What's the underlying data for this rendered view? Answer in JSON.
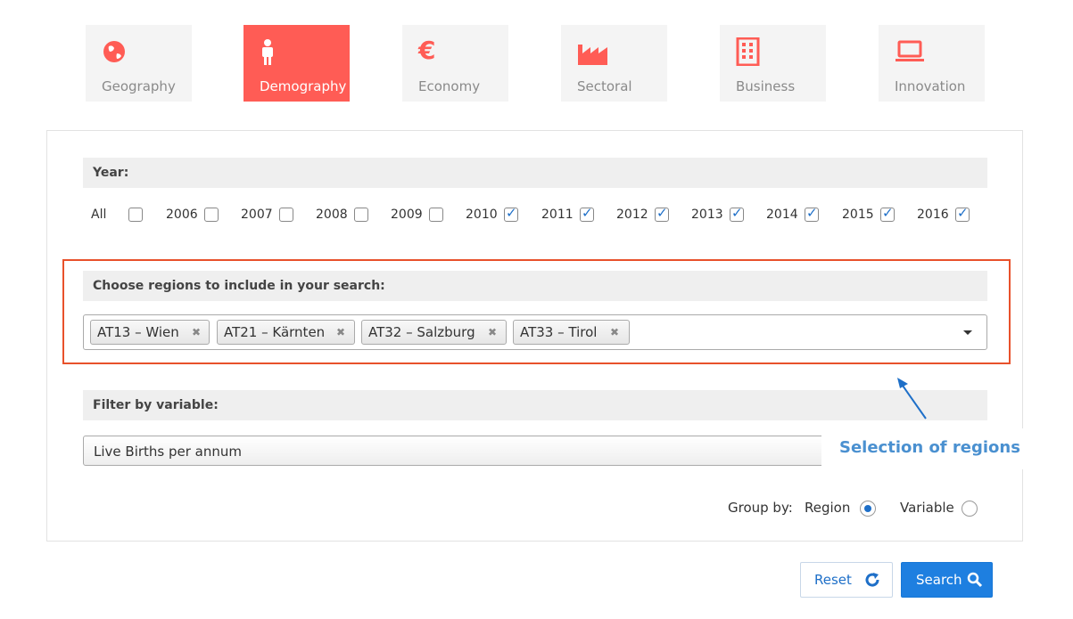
{
  "tabs": [
    {
      "label": "Geography",
      "icon": "globe-icon",
      "active": false
    },
    {
      "label": "Demography",
      "icon": "person-icon",
      "active": true
    },
    {
      "label": "Economy",
      "icon": "euro-icon",
      "active": false
    },
    {
      "label": "Sectoral",
      "icon": "factory-icon",
      "active": false
    },
    {
      "label": "Business",
      "icon": "building-icon",
      "active": false
    },
    {
      "label": "Innovation",
      "icon": "laptop-icon",
      "active": false
    }
  ],
  "year": {
    "heading": "Year:",
    "all_label": "All",
    "all_checked": false,
    "options": [
      {
        "label": "2006",
        "checked": false
      },
      {
        "label": "2007",
        "checked": false
      },
      {
        "label": "2008",
        "checked": false
      },
      {
        "label": "2009",
        "checked": false
      },
      {
        "label": "2010",
        "checked": true
      },
      {
        "label": "2011",
        "checked": true
      },
      {
        "label": "2012",
        "checked": true
      },
      {
        "label": "2013",
        "checked": true
      },
      {
        "label": "2014",
        "checked": true
      },
      {
        "label": "2015",
        "checked": true
      },
      {
        "label": "2016",
        "checked": true
      }
    ]
  },
  "regions": {
    "heading": "Choose regions to include in your search:",
    "selected": [
      "AT13 – Wien",
      "AT21 – Kärnten",
      "AT32 – Salzburg",
      "AT33 – Tirol"
    ]
  },
  "variable": {
    "heading": "Filter by variable:",
    "selected": "Live Births per annum"
  },
  "annotation": {
    "text": "Selection of regions",
    "color": "#4a90d0"
  },
  "group_by": {
    "label": "Group by:",
    "options": [
      {
        "label": "Region",
        "selected": true
      },
      {
        "label": "Variable",
        "selected": false
      }
    ]
  },
  "buttons": {
    "reset_label": "Reset",
    "search_label": "Search"
  },
  "colors": {
    "accent": "#ff5c55",
    "primary": "#1e7fe0",
    "highlight": "#e8512b"
  }
}
